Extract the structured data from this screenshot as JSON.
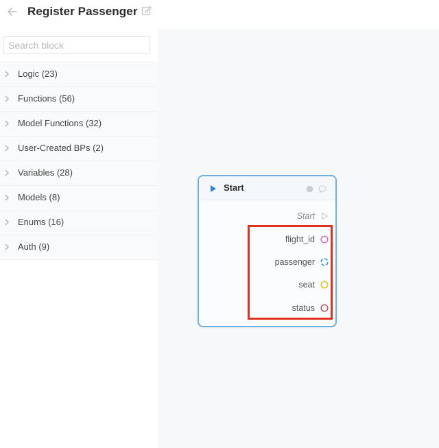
{
  "header": {
    "title": "Register Passenger"
  },
  "sidebar": {
    "search_placeholder": "Search block",
    "categories": [
      {
        "label": "Logic (23)"
      },
      {
        "label": "Functions (56)"
      },
      {
        "label": "Model Functions (32)"
      },
      {
        "label": "User-Created BPs (2)"
      },
      {
        "label": "Variables (28)"
      },
      {
        "label": "Models (8)"
      },
      {
        "label": "Enums (16)"
      },
      {
        "label": "Auth (9)"
      }
    ]
  },
  "node": {
    "title": "Start",
    "flow_output_label": "Start",
    "outputs": [
      {
        "label": "flight_id",
        "port_color": "#d36bb5"
      },
      {
        "label": "passenger",
        "port_color": "#3b8fd6"
      },
      {
        "label": "seat",
        "port_color": "#e0c21f"
      },
      {
        "label": "status",
        "port_color": "#b0525a"
      }
    ]
  },
  "colors": {
    "node_border": "#6fb1e6",
    "highlight": "#e0301e",
    "play_icon": "#2b86d6"
  }
}
